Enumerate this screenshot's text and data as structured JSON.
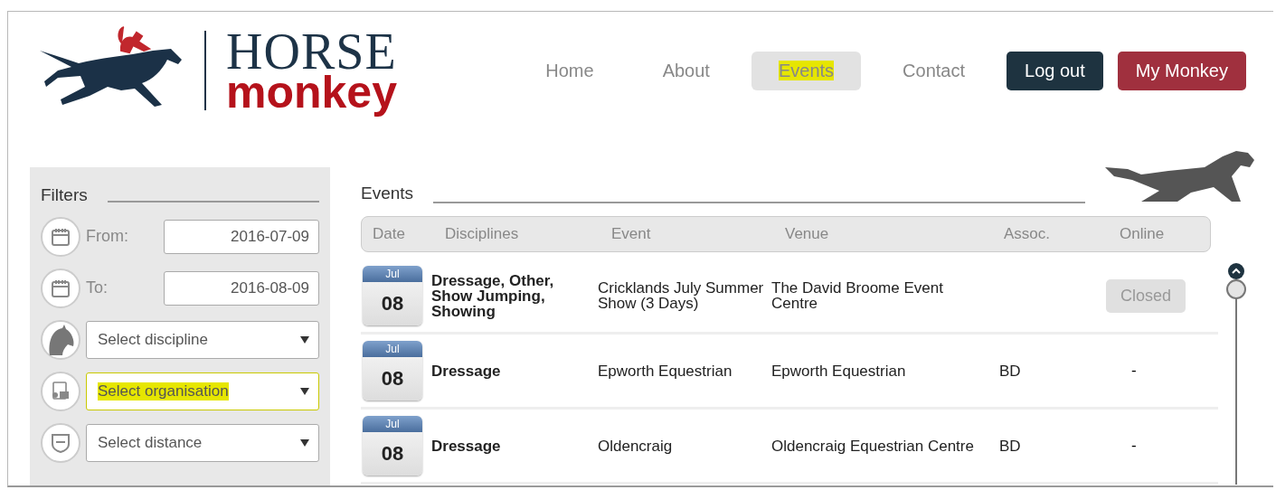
{
  "logo": {
    "word_top": "HORSE",
    "word_bottom": "monkey"
  },
  "nav": [
    {
      "label": "Home",
      "selected": false,
      "highlighted": false,
      "kind": "link"
    },
    {
      "label": "About",
      "selected": false,
      "highlighted": false,
      "kind": "link"
    },
    {
      "label": "Events",
      "selected": true,
      "highlighted": true,
      "kind": "link"
    },
    {
      "label": "Contact",
      "selected": false,
      "highlighted": false,
      "kind": "link"
    },
    {
      "label": "Log out",
      "selected": false,
      "highlighted": false,
      "kind": "dark"
    },
    {
      "label": "My Monkey",
      "selected": false,
      "highlighted": false,
      "kind": "red"
    }
  ],
  "filters": {
    "title": "Filters",
    "items": [
      {
        "kind": "date",
        "label": "From:",
        "value": "2016-07-09",
        "highlighted": false
      },
      {
        "kind": "date",
        "label": "To:",
        "value": "2016-08-09",
        "highlighted": false
      },
      {
        "kind": "select",
        "placeholder": "Select discipline",
        "highlighted": false
      },
      {
        "kind": "select",
        "placeholder": "Select organisation",
        "highlighted": true
      },
      {
        "kind": "select",
        "placeholder": "Select distance",
        "highlighted": false
      }
    ]
  },
  "events": {
    "title": "Events",
    "columns": [
      "Date",
      "Disciplines",
      "Event",
      "Venue",
      "Assoc.",
      "Online"
    ],
    "rows": [
      {
        "month": "Jul",
        "day": "08",
        "disciplines": "Dressage, Other, Show Jumping, Showing",
        "event": "Cricklands July Summer Show (3 Days)",
        "venue": "The David Broome Event Centre",
        "assoc": "",
        "online": {
          "kind": "button",
          "text": "Closed"
        }
      },
      {
        "month": "Jul",
        "day": "08",
        "disciplines": "Dressage",
        "event": "Epworth Equestrian",
        "venue": "Epworth Equestrian",
        "assoc": "BD",
        "online": {
          "kind": "text",
          "text": "-"
        }
      },
      {
        "month": "Jul",
        "day": "08",
        "disciplines": "Dressage",
        "event": "Oldencraig",
        "venue": "Oldencraig Equestrian Centre",
        "assoc": "BD",
        "online": {
          "kind": "text",
          "text": "-"
        }
      }
    ]
  }
}
